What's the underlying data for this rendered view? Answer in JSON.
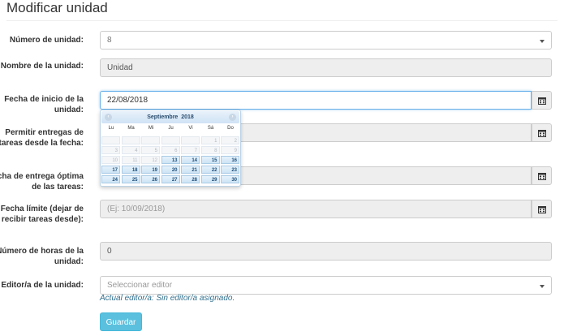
{
  "page": {
    "title": "Modificar unidad"
  },
  "form": {
    "unit_number": {
      "label": "Número de unidad:",
      "value": "8"
    },
    "unit_name": {
      "label": "Nombre de la unidad:",
      "value": "Unidad"
    },
    "start_date": {
      "label": "Fecha de inicio de la unidad:",
      "value": "22/08/2018"
    },
    "allow_from": {
      "label": "Permitir entregas de tareas desde la fecha:",
      "value": ""
    },
    "optimal_date": {
      "label": "Fecha de entrega óptima de las tareas:",
      "value": ""
    },
    "deadline": {
      "label": "Fecha límite (dejar de recibir tareas desde):",
      "placeholder": "(Ej: 10/09/2018)"
    },
    "hours": {
      "label": "Número de horas de la unidad:",
      "value": "0"
    },
    "editor": {
      "label": "Editor/a de la unidad:",
      "placeholder": "Seleccionar editor",
      "help": "Actual editor/a: Sin editor/a asignado."
    },
    "save_label": "Guardar"
  },
  "datepicker": {
    "month_label": "Septiembre  2018",
    "prev_icon": "‹",
    "next_icon": "›",
    "weekdays": [
      "Lu",
      "Ma",
      "Mi",
      "Ju",
      "Vi",
      "Sá",
      "Do"
    ],
    "weeks": [
      [
        {
          "d": "",
          "a": false
        },
        {
          "d": "",
          "a": false
        },
        {
          "d": "",
          "a": false
        },
        {
          "d": "",
          "a": false
        },
        {
          "d": "",
          "a": false
        },
        {
          "d": "1",
          "a": false
        },
        {
          "d": "2",
          "a": false
        }
      ],
      [
        {
          "d": "3",
          "a": false
        },
        {
          "d": "4",
          "a": false
        },
        {
          "d": "5",
          "a": false
        },
        {
          "d": "6",
          "a": false
        },
        {
          "d": "7",
          "a": false
        },
        {
          "d": "8",
          "a": false
        },
        {
          "d": "9",
          "a": false
        }
      ],
      [
        {
          "d": "10",
          "a": false
        },
        {
          "d": "11",
          "a": false
        },
        {
          "d": "12",
          "a": false
        },
        {
          "d": "13",
          "a": true
        },
        {
          "d": "14",
          "a": true
        },
        {
          "d": "15",
          "a": true
        },
        {
          "d": "16",
          "a": true
        }
      ],
      [
        {
          "d": "17",
          "a": true
        },
        {
          "d": "18",
          "a": true
        },
        {
          "d": "19",
          "a": true
        },
        {
          "d": "20",
          "a": true
        },
        {
          "d": "21",
          "a": true
        },
        {
          "d": "22",
          "a": true
        },
        {
          "d": "23",
          "a": true
        }
      ],
      [
        {
          "d": "24",
          "a": true
        },
        {
          "d": "25",
          "a": true
        },
        {
          "d": "26",
          "a": true
        },
        {
          "d": "27",
          "a": true
        },
        {
          "d": "28",
          "a": true
        },
        {
          "d": "29",
          "a": true
        },
        {
          "d": "30",
          "a": true
        }
      ]
    ]
  },
  "icons": {
    "calendar": "calendar-icon",
    "dropdown": "chevron-down-icon"
  },
  "colors": {
    "accent": "#5bc0de",
    "help": "#31708f",
    "focus": "#66afe9"
  }
}
